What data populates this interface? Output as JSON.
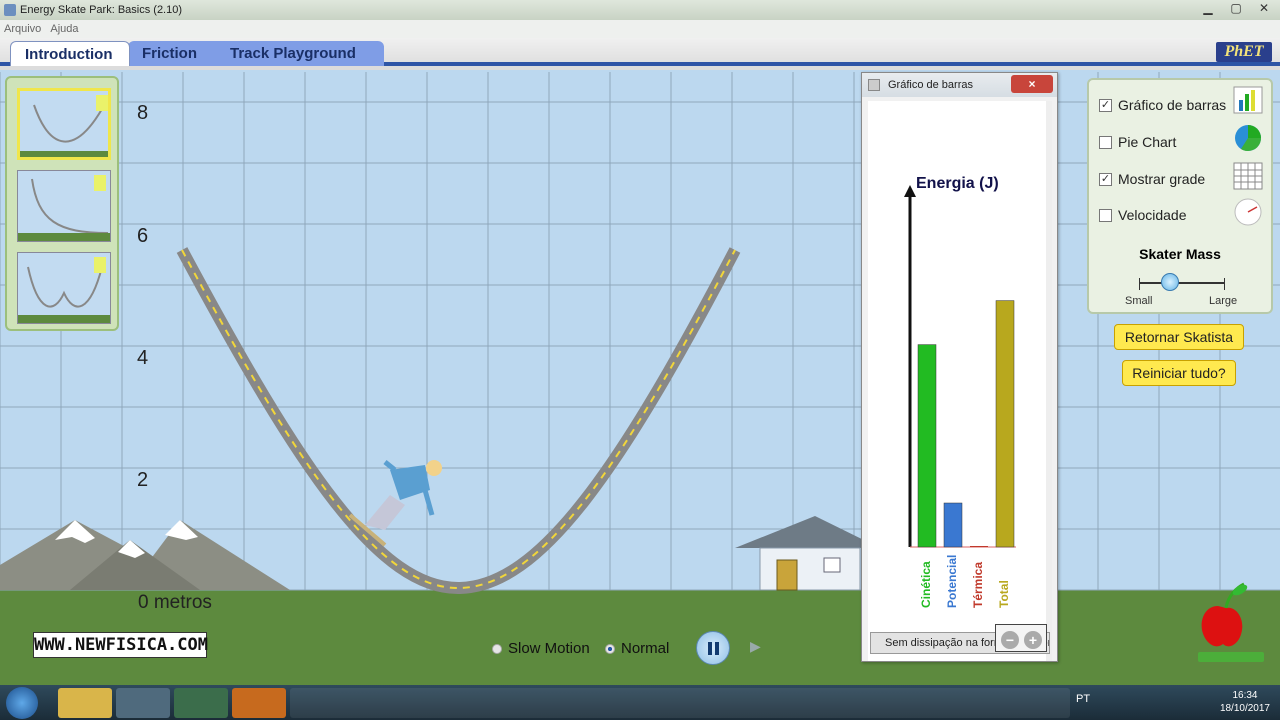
{
  "window": {
    "title": "Energy Skate Park: Basics (2.10)",
    "menu": [
      "Arquivo",
      "Ajuda"
    ]
  },
  "tabs": [
    "Introduction",
    "Friction",
    "Track Playground"
  ],
  "logo": "PhET",
  "axis": {
    "ticks": [
      "8",
      "6",
      "4",
      "2"
    ],
    "zero_label": "0 metros"
  },
  "bar_chart_dialog": {
    "title": "Gráfico de barras",
    "close_icon": "×",
    "dissipation_button": "Sem dissipação na forma de calor",
    "zoom_out": "−",
    "zoom_in": "+",
    "chart_data": {
      "type": "bar",
      "title": "Energia (J)",
      "categories": [
        "Cinética",
        "Potencial",
        "Térmica",
        "Total"
      ],
      "values": [
        4.6,
        1.0,
        0.0,
        5.6
      ],
      "colors": [
        "#22bb22",
        "#3a78d1",
        "#c0392b",
        "#b8a81e"
      ]
    }
  },
  "controls": {
    "bar_graph": {
      "label": "Gráfico de barras",
      "checked": true
    },
    "pie_chart": {
      "label": "Pie Chart",
      "checked": false
    },
    "grid": {
      "label": "Mostrar grade",
      "checked": true
    },
    "speed": {
      "label": "Velocidade",
      "checked": false
    },
    "mass_title": "Skater Mass",
    "mass_small": "Small",
    "mass_large": "Large",
    "mass_value": 0.4,
    "checkmark": "✓"
  },
  "buttons": {
    "return_skater": "Retornar Skatista",
    "reset_all": "Reiniciar tudo?"
  },
  "playback": {
    "slow_motion": "Slow Motion",
    "normal": "Normal",
    "selected": "Normal",
    "step_icon": "▶"
  },
  "watermark": "WWW.NEWFISICA.COM",
  "taskbar": {
    "language": "PT",
    "time": "16:34",
    "date": "18/10/2017"
  },
  "colors": {
    "sky": "#bcd8ef",
    "ground": "#5d8a3e",
    "tab_accent": "#2e55a6",
    "button_yellow": "#ffe94f"
  }
}
